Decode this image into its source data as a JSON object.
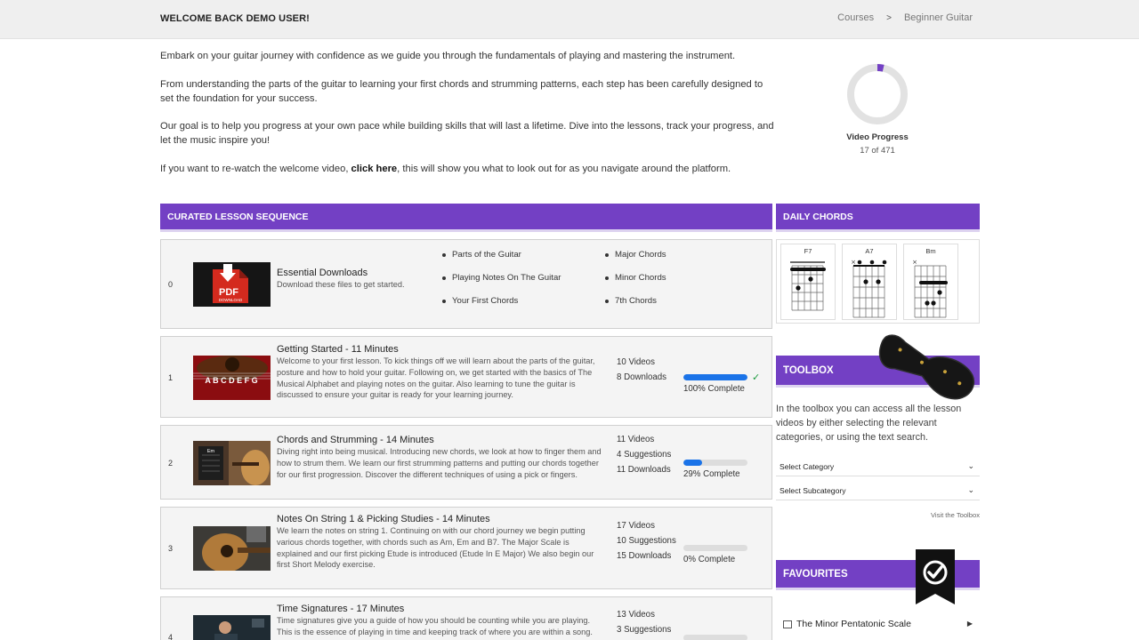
{
  "header": {
    "welcome": "WELCOME BACK DEMO USER!",
    "breadcrumb": [
      "Courses",
      "Beginner Guitar"
    ]
  },
  "intro": {
    "p1": "Embark on your guitar journey with confidence as we guide you through the fundamentals of playing and mastering the instrument.",
    "p2": "From understanding the parts of the guitar to learning your first chords and strumming patterns, each step has been carefully designed to set the foundation for your success.",
    "p3": "Our goal is to help you progress at your own pace while building skills that will last a lifetime. Dive into the lessons, track your progress, and let the music inspire you!",
    "p4_before": "If you want to re-watch the welcome video, ",
    "p4_link": "click here",
    "p4_after": ", this will show you what to look out for as you navigate around the platform."
  },
  "progress": {
    "label": "Video Progress",
    "count": "17 of 471",
    "watched": 17,
    "total": 471,
    "color": "#7340c4",
    "track_color": "#e2e2e2"
  },
  "sections": {
    "lessons_title": "CURATED LESSON SEQUENCE",
    "daily_title": "DAILY CHORDS",
    "toolbox_title": "TOOLBOX",
    "favourites_title": "FAVOURITES"
  },
  "lesson0": {
    "num": "0",
    "title": "Essential Downloads",
    "desc": "Download these files to get started.",
    "thumb_label": "PDF",
    "thumb_sub": "DOWNLOAD",
    "col1": [
      "Parts of the Guitar",
      "Playing Notes On The Guitar",
      "Your First Chords"
    ],
    "col2": [
      "Major Chords",
      "Minor Chords",
      "7th Chords"
    ]
  },
  "lessons": [
    {
      "num": "1",
      "title": "Getting Started - 11 Minutes",
      "desc": "Welcome to your first lesson. To kick things off we will learn about the parts of the guitar, posture and how to hold your guitar. Following on, we get started with the basics of The Musical Alphabet and playing notes on the guitar. Also learning to tune the guitar is discussed to ensure your guitar is ready for your learning journey.",
      "videos": "10 Videos",
      "suggestions": "",
      "downloads": "8 Downloads",
      "percent": 100,
      "complete": "100% Complete",
      "check": "✓",
      "thumb_text": "A B C D E F G"
    },
    {
      "num": "2",
      "title": "Chords and Strumming - 14 Minutes",
      "desc": "Diving right into being musical. Introducing new chords, we look at how to finger them and how to strum them. We learn our first strumming patterns and putting our chords together for our first progression. Discover the different techniques of using a pick or fingers.",
      "videos": "11 Videos",
      "suggestions": "4 Suggestions",
      "downloads": "11 Downloads",
      "percent": 29,
      "complete": "29% Complete",
      "check": "",
      "thumb_text": "Em"
    },
    {
      "num": "3",
      "title": "Notes On String 1 & Picking Studies - 14 Minutes",
      "desc": "We learn the notes on string 1. Continuing on with our chord journey we begin putting various chords together, with chords such as Am, Em and B7. The Major Scale is explained and our first picking Etude is introduced (Etude In E Major) We also begin our first Short Melody exercise.",
      "videos": "17 Videos",
      "suggestions": "10 Suggestions",
      "downloads": "15 Downloads",
      "percent": 0,
      "complete": "0% Complete",
      "check": "",
      "thumb_text": ""
    },
    {
      "num": "4",
      "title": "Time Signatures - 17 Minutes",
      "desc": "Time signatures give you a guide of how you should be counting while you are playing. This is the essence of playing in time and keeping track of where you are within a song. We",
      "videos": "13 Videos",
      "suggestions": "3 Suggestions",
      "downloads": "",
      "percent": 0,
      "complete": "",
      "check": "",
      "thumb_text": ""
    }
  ],
  "daily_chords": [
    "F7",
    "A7",
    "Bm"
  ],
  "toolbox": {
    "text": "In the toolbox you can access all the lesson videos by either selecting the relevant categories, or using the text search.",
    "category": "Select Category",
    "subcategory": "Select Subcategory",
    "visit": "Visit the Toolbox"
  },
  "favourites": {
    "item": "The Minor Pentatonic Scale"
  }
}
